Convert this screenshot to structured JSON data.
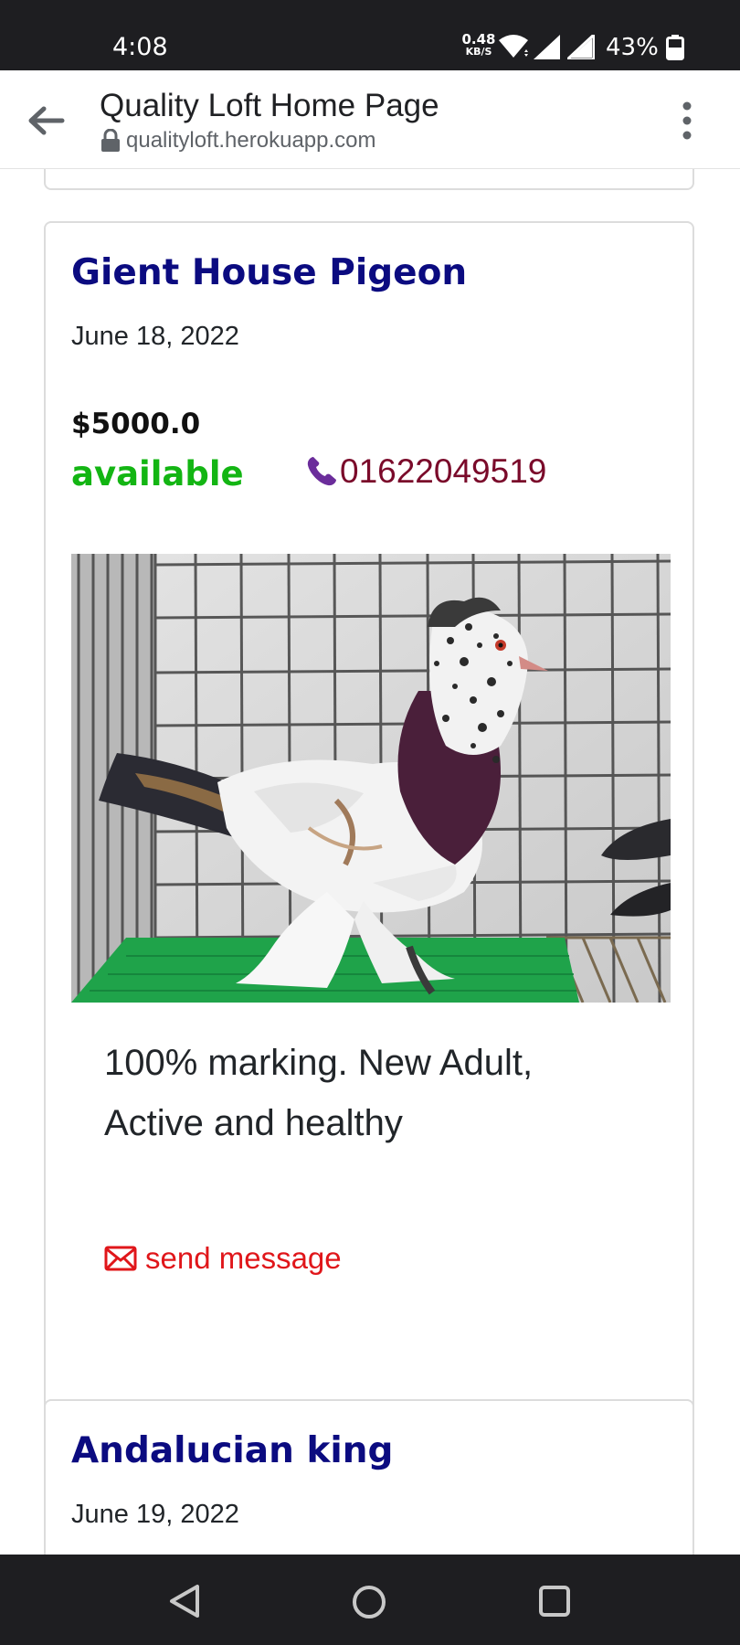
{
  "status_bar": {
    "time": "4:08",
    "net_speed_value": "0.48",
    "net_speed_unit": "KB/S",
    "battery": "43%"
  },
  "browser": {
    "page_title": "Quality Loft Home Page",
    "url": "qualityloft.herokuapp.com"
  },
  "listings": [
    {
      "title": "Gient House Pigeon",
      "date": "June 18, 2022",
      "price": "$5000.0",
      "status": "available",
      "phone": "01622049519",
      "description": "100% marking. New Adult, Active and healthy",
      "message_label": "send message"
    },
    {
      "title": "Andalucian king",
      "date": "June 19, 2022"
    }
  ],
  "colors": {
    "title": "#0b0b80",
    "available": "#13b513",
    "phone": "#7a0a2a",
    "phone_icon": "#6b2d9b",
    "message": "#e0161a",
    "system_bars": "#1e1e21"
  },
  "icons": {
    "back": "arrow-left-icon",
    "lock": "lock-icon",
    "menu": "kebab-menu-icon",
    "phone": "phone-icon",
    "mail": "envelope-icon"
  }
}
